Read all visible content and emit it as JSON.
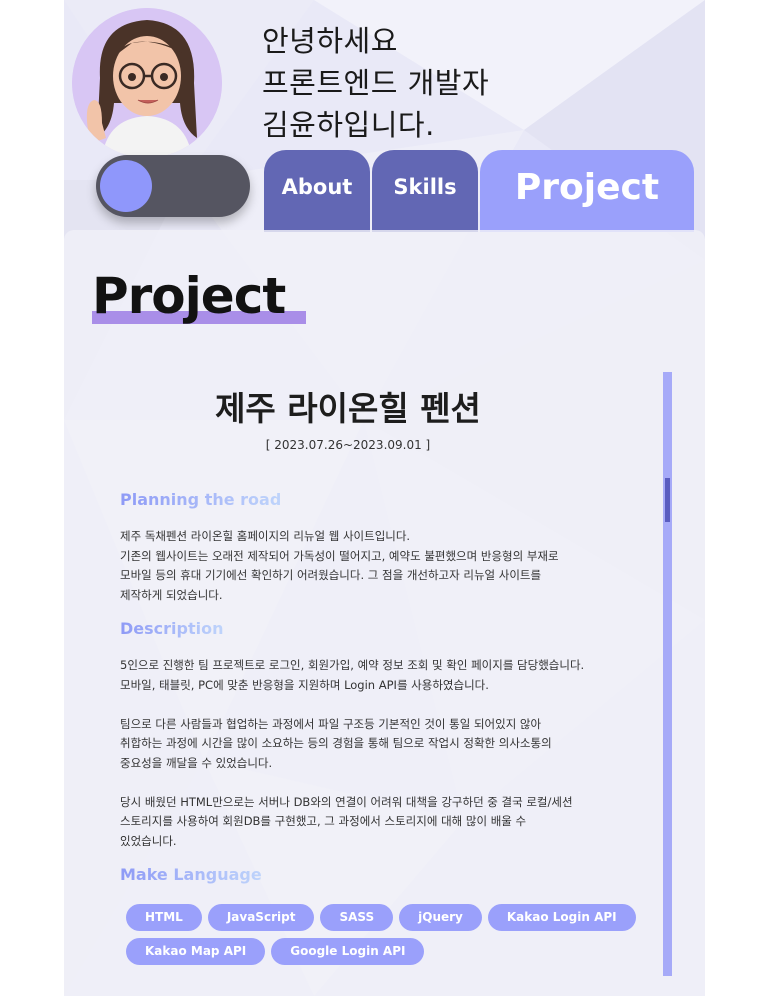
{
  "header": {
    "greeting": [
      "안녕하세요",
      "프론트엔드 개발자",
      "김윤하입니다."
    ]
  },
  "theme_toggle": {
    "state": "off"
  },
  "tabs": [
    {
      "label": "About",
      "active": false
    },
    {
      "label": "Skills",
      "active": false
    },
    {
      "label": "Project",
      "active": true
    }
  ],
  "section_title": "Project",
  "project": {
    "name": "제주 라이온힐 펜션",
    "date": "[ 2023.07.26~2023.09.01 ]",
    "planning_title": "Planning the road",
    "planning": [
      "제주 독채펜션 라이온힐 홈페이지의 리뉴얼 웹 사이트입니다.",
      "기존의 웹사이트는 오래전 제작되어 가독성이 떨어지고, 예약도 불편했으며 반응형의 부재로",
      "모바일 등의 휴대 기기에선 확인하기 어려웠습니다. 그 점을 개선하고자 리뉴얼 사이트를",
      "제작하게 되었습니다."
    ],
    "description_title": "Description",
    "description": [
      [
        "5인으로 진행한 팀 프로젝트로 로그인, 회원가입, 예약 정보 조회 및 확인 페이지를 담당했습니다.",
        "모바일, 태블릿, PC에 맞춘 반응형을 지원하며 Login API를 사용하였습니다."
      ],
      [
        "팀으로 다른 사람들과 협업하는 과정에서 파일 구조등 기본적인 것이 통일 되어있지 않아",
        "취합하는 과정에 시간을 많이 소요하는 등의 경험을 통해 팀으로 작업시 정확한 의사소통의",
        "중요성을 깨달을 수 있었습니다."
      ],
      [
        "당시 배웠던 HTML만으로는 서버나 DB와의 연결이 어려워 대책을 강구하던 중 결국 로컬/세션",
        "스토리지를 사용하여 회원DB를 구현했고, 그 과정에서 스토리지에 대해 많이 배울 수",
        "있었습니다."
      ]
    ],
    "language_title": "Make Language",
    "languages": [
      "HTML",
      "JavaScript",
      "SASS",
      "jQuery",
      "Kakao Login API",
      "Kakao Map API",
      "Google Login API"
    ]
  },
  "colors": {
    "accent": "#9aa0fb",
    "tab_inactive": "#6267b4",
    "underline": "#a98ee8",
    "toggle_bg": "#555561"
  },
  "icons": [
    "avatar-image"
  ]
}
